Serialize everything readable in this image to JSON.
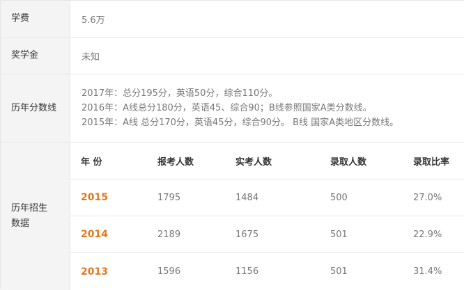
{
  "fees": {
    "label": "学费",
    "value": "5.6万"
  },
  "scholarship": {
    "label": "奖学金",
    "value": "未知"
  },
  "cutoff": {
    "label": "历年分数线",
    "lines": [
      "2017年：总分195分，英语50分，综合110分。",
      "2016年：A线总分180分，英语45、综合90；B线参照国家A类分数线。",
      "2015年：A线 总分170分，英语45分，综合90分。 B线 国家A类地区分数线。"
    ]
  },
  "admissions": {
    "label": "历年招生数据",
    "headers": [
      "年 份",
      "报考人数",
      "实考人数",
      "录取人数",
      "录取比率"
    ],
    "rows": [
      [
        "2015",
        "1795",
        "1484",
        "500",
        "27.0%"
      ],
      [
        "2014",
        "2189",
        "1675",
        "501",
        "22.9%"
      ],
      [
        "2013",
        "1596",
        "1156",
        "501",
        "31.4%"
      ]
    ]
  }
}
